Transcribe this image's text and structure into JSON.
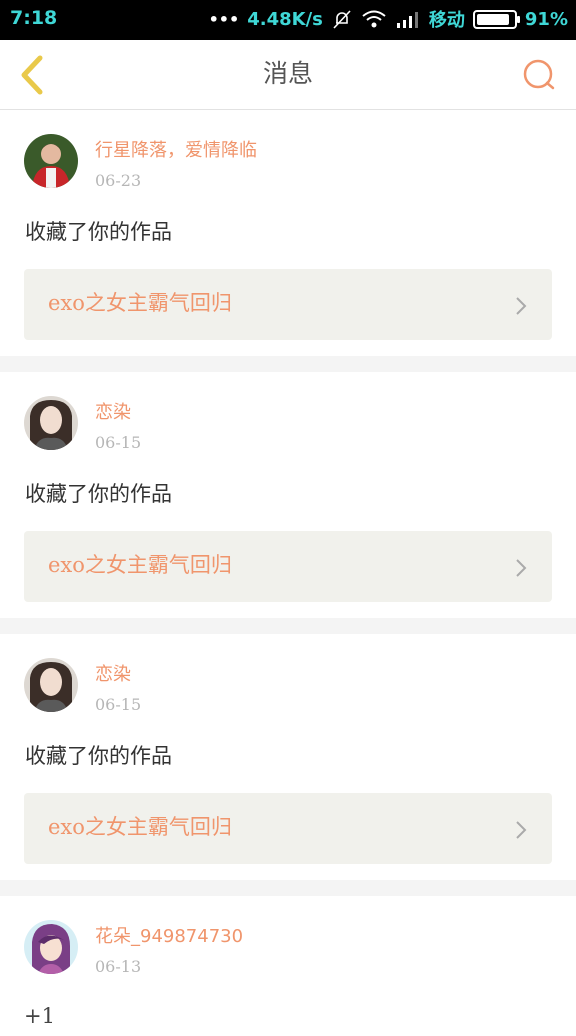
{
  "status_bar": {
    "time": "7:18",
    "net_speed": "4.48K/s",
    "carrier": "移动",
    "battery": "91%"
  },
  "header": {
    "title": "消息"
  },
  "messages": [
    {
      "username": "行星降落，爱情降临",
      "date": "06-23",
      "action": "收藏了你的作品",
      "work": "exo之女主霸气回归"
    },
    {
      "username": "恋染",
      "date": "06-15",
      "action": "收藏了你的作品",
      "work": "exo之女主霸气回归"
    },
    {
      "username": "恋染",
      "date": "06-15",
      "action": "收藏了你的作品",
      "work": "exo之女主霸气回归"
    },
    {
      "username": "花朵_949874730",
      "date": "06-13",
      "action": "+1"
    }
  ],
  "colors": {
    "accent": "#f0956c",
    "back_arrow": "#e9c94a",
    "status_text": "#3fd7d6"
  },
  "icons": {
    "back": "chevron-left-icon",
    "search": "search-icon",
    "work_arrow": "chevron-right-icon"
  }
}
